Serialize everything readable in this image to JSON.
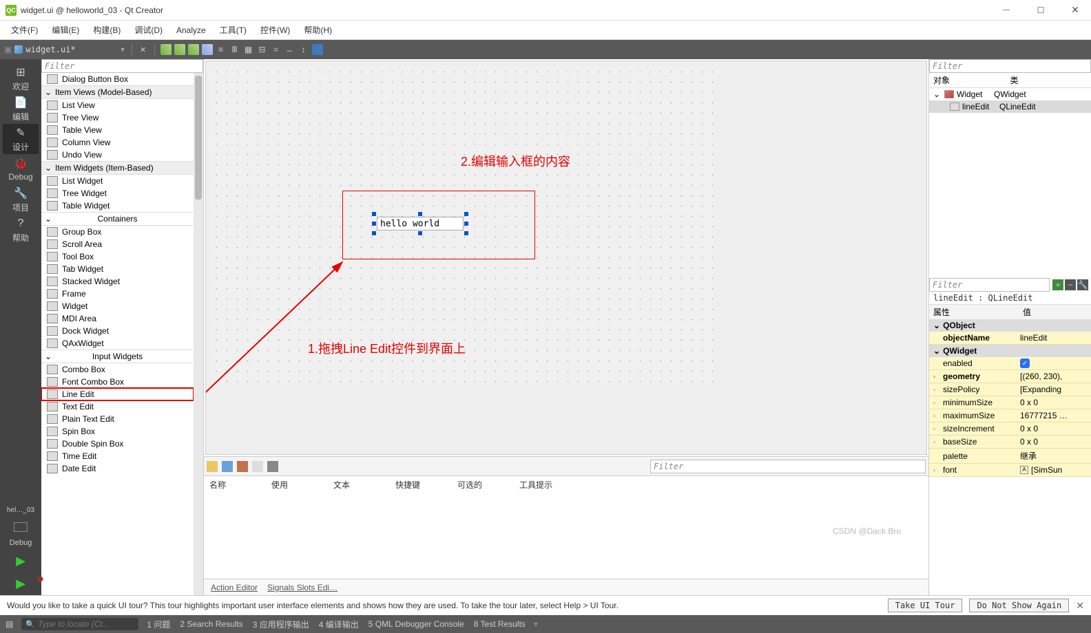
{
  "titlebar": {
    "icon": "QC",
    "title": "widget.ui @ helloworld_03 - Qt Creator"
  },
  "menubar": [
    "文件(F)",
    "编辑(E)",
    "构建(B)",
    "调试(D)",
    "Analyze",
    "工具(T)",
    "控件(W)",
    "帮助(H)"
  ],
  "toolbar": {
    "doc": "widget.ui*"
  },
  "leftrail": {
    "items": [
      {
        "icon": "⊞",
        "label": "欢迎"
      },
      {
        "icon": "📄",
        "label": "编辑"
      },
      {
        "icon": "✎",
        "label": "设计",
        "active": true
      },
      {
        "icon": "🐞",
        "label": "Debug"
      },
      {
        "icon": "🔧",
        "label": "项目"
      },
      {
        "icon": "?",
        "label": "帮助"
      }
    ],
    "file": "hel…_03",
    "debug": "Debug"
  },
  "widgetbox": {
    "filter": "Filter",
    "cats": [
      {
        "type": "item",
        "label": "Dialog Button Box"
      },
      {
        "type": "cat",
        "label": "Item Views (Model-Based)"
      },
      {
        "type": "item",
        "label": "List View"
      },
      {
        "type": "item",
        "label": "Tree View"
      },
      {
        "type": "item",
        "label": "Table View"
      },
      {
        "type": "item",
        "label": "Column View"
      },
      {
        "type": "item",
        "label": "Undo View"
      },
      {
        "type": "cat",
        "label": "Item Widgets (Item-Based)"
      },
      {
        "type": "item",
        "label": "List Widget"
      },
      {
        "type": "item",
        "label": "Tree Widget"
      },
      {
        "type": "item",
        "label": "Table Widget"
      },
      {
        "type": "cat",
        "label": "Containers",
        "center": true
      },
      {
        "type": "item",
        "label": "Group Box"
      },
      {
        "type": "item",
        "label": "Scroll Area"
      },
      {
        "type": "item",
        "label": "Tool Box"
      },
      {
        "type": "item",
        "label": "Tab Widget"
      },
      {
        "type": "item",
        "label": "Stacked Widget"
      },
      {
        "type": "item",
        "label": "Frame"
      },
      {
        "type": "item",
        "label": "Widget"
      },
      {
        "type": "item",
        "label": "MDI Area"
      },
      {
        "type": "item",
        "label": "Dock Widget"
      },
      {
        "type": "item",
        "label": "QAxWidget"
      },
      {
        "type": "cat",
        "label": "Input Widgets",
        "center": true
      },
      {
        "type": "item",
        "label": "Combo Box"
      },
      {
        "type": "item",
        "label": "Font Combo Box"
      },
      {
        "type": "item",
        "label": "Line Edit",
        "hl": true
      },
      {
        "type": "item",
        "label": "Text Edit"
      },
      {
        "type": "item",
        "label": "Plain Text Edit"
      },
      {
        "type": "item",
        "label": "Spin Box"
      },
      {
        "type": "item",
        "label": "Double Spin Box"
      },
      {
        "type": "item",
        "label": "Time Edit"
      },
      {
        "type": "item",
        "label": "Date Edit"
      }
    ]
  },
  "canvas": {
    "lineedit_value": "hello world",
    "anno2": "2.编辑输入框的内容",
    "anno1": "1.拖拽Line Edit控件到界面上"
  },
  "actiontable": {
    "filter": "Filter",
    "cols": [
      "名称",
      "使用",
      "文本",
      "快捷键",
      "可选的",
      "工具提示"
    ],
    "tabs": [
      "Action Editor",
      "Signals Slots Edi…"
    ]
  },
  "objtree": {
    "filter": "Filter",
    "hdr": [
      "对象",
      "类"
    ],
    "rows": [
      {
        "name": "Widget",
        "class": "QWidget",
        "root": true
      },
      {
        "name": "lineEdit",
        "class": "QLineEdit",
        "sel": true
      }
    ]
  },
  "props": {
    "filter": "Filter",
    "obj": "lineEdit : QLineEdit",
    "hdr": [
      "属性",
      "值"
    ],
    "groups": [
      {
        "group": "QObject"
      },
      {
        "k": "objectName",
        "v": "lineEdit",
        "bold": true
      },
      {
        "group": "QWidget"
      },
      {
        "k": "enabled",
        "check": true
      },
      {
        "k": "geometry",
        "v": "[(260, 230),",
        "bold": true,
        "exp": true
      },
      {
        "k": "sizePolicy",
        "v": "[Expanding",
        "exp": true
      },
      {
        "k": "minimumSize",
        "v": "0 x 0",
        "exp": true
      },
      {
        "k": "maximumSize",
        "v": "16777215 …",
        "exp": true
      },
      {
        "k": "sizeIncrement",
        "v": "0 x 0",
        "exp": true
      },
      {
        "k": "baseSize",
        "v": "0 x 0",
        "exp": true
      },
      {
        "k": "palette",
        "v": "继承"
      },
      {
        "k": "font",
        "v": "[SimSun",
        "exp": true,
        "ficon": true
      }
    ]
  },
  "infobar": {
    "msg": "Would you like to take a quick UI tour? This tour highlights important user interface elements and shows how they are used. To take the tour later, select Help > UI Tour.",
    "btn1": "Take UI Tour",
    "btn2": "Do Not Show Again"
  },
  "statusbar": {
    "search": "Type to locate (Ct…",
    "items": [
      "1 问题",
      "2 Search Results",
      "3 应用程序输出",
      "4 编译输出",
      "5 QML Debugger Console",
      "8 Test Results"
    ]
  },
  "watermark": "CSDN @Dack Bro"
}
